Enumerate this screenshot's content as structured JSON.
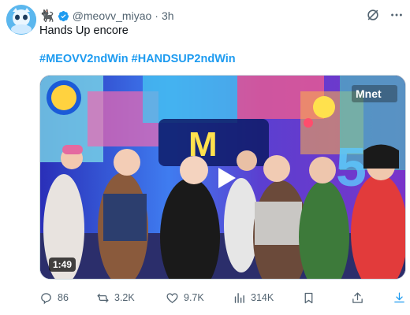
{
  "tweet": {
    "display_emoji": "🐈‍⬛",
    "handle": "@meovv_miyao",
    "separator": "·",
    "time": "3h",
    "text": "Hands Up encore",
    "hashtags": [
      "#MEOVV2ndWin",
      "#HANDSUP2ndWin"
    ]
  },
  "media": {
    "duration": "1:49",
    "play_icon": "play-icon",
    "overlay_logo": "Mnet",
    "stage_sign_letter": "M"
  },
  "actions": {
    "replies": "86",
    "reposts": "3.2K",
    "likes": "9.7K",
    "views": "314K"
  },
  "colors": {
    "link": "#1d9bf0",
    "muted": "#536471",
    "text": "#0f1419",
    "verified": "#1d9bf0"
  }
}
